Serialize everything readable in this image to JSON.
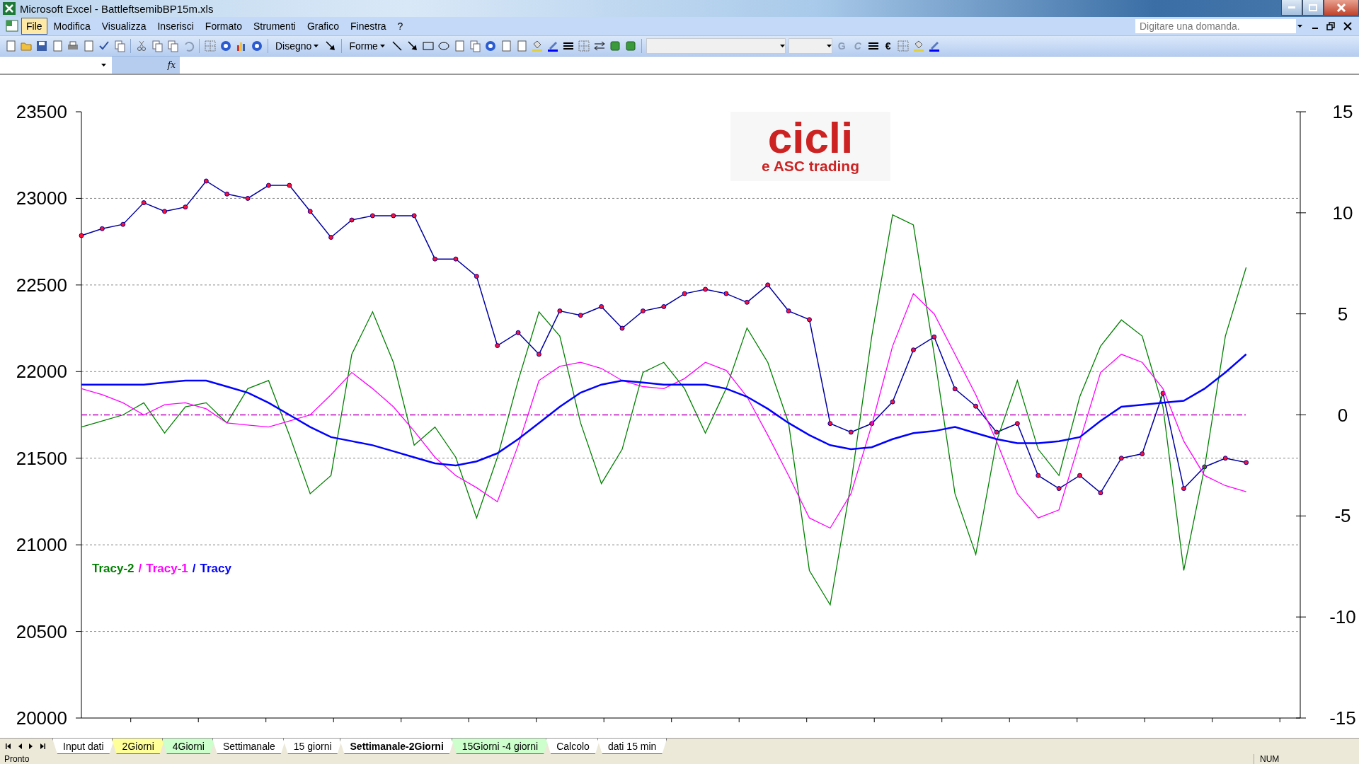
{
  "window": {
    "title": "Microsoft Excel - BattleftsemibBP15m.xls"
  },
  "menu": [
    {
      "label": "File",
      "selected": true
    },
    {
      "label": "Modifica",
      "selected": false
    },
    {
      "label": "Visualizza",
      "selected": false
    },
    {
      "label": "Inserisci",
      "selected": false
    },
    {
      "label": "Formato",
      "selected": false
    },
    {
      "label": "Strumenti",
      "selected": false
    },
    {
      "label": "Grafico",
      "selected": false
    },
    {
      "label": "Finestra",
      "selected": false
    },
    {
      "label": "?",
      "selected": false
    }
  ],
  "help_search": {
    "placeholder": "Digitare una domanda."
  },
  "drawing_toolbar": {
    "draw_menu": "Disegno",
    "shapes_menu": "Forme"
  },
  "format_toolbar": {
    "bold": "G",
    "italic": "C",
    "euro": "€"
  },
  "formula_bar": {
    "fx": "fx"
  },
  "logo": {
    "title": "cicli",
    "subtitle": "e ASC trading"
  },
  "legend": {
    "separators": [
      "/",
      "/"
    ]
  },
  "chart_price": {
    "chart_data": {
      "type": "line",
      "grid": true,
      "categories": [
        null,
        null,
        null,
        null,
        null,
        null,
        null,
        null,
        null,
        null,
        null,
        null,
        null,
        null,
        null,
        null,
        null,
        null,
        null,
        null,
        null,
        null,
        null,
        null,
        null,
        null,
        null,
        null,
        null,
        null,
        null,
        null,
        null,
        null,
        null,
        null,
        null,
        null,
        null,
        null,
        null,
        null,
        null,
        null,
        null,
        null,
        null,
        null,
        null,
        null,
        null,
        null,
        null,
        null,
        null,
        null,
        null
      ],
      "ylim": [
        20000,
        23500
      ],
      "yticks": [
        {
          "value": 20000,
          "label": "20000"
        },
        {
          "value": 20500,
          "label": "20500"
        },
        {
          "value": 21000,
          "label": "21000"
        },
        {
          "value": 21500,
          "label": "21500"
        },
        {
          "value": 22000,
          "label": "22000"
        },
        {
          "value": 22500,
          "label": "22500"
        },
        {
          "value": 23000,
          "label": "23000"
        },
        {
          "value": 23500,
          "label": "23500"
        }
      ],
      "series": [
        {
          "color": "#0000a0",
          "marker": "circle",
          "values": [
            22785,
            22825,
            22850,
            22975,
            22925,
            22950,
            23100,
            23025,
            23000,
            23075,
            23075,
            22925,
            22775,
            22875,
            22900,
            22900,
            22900,
            22650,
            22650,
            22550,
            22150,
            22225,
            22100,
            22350,
            22325,
            22375,
            22250,
            22350,
            22375,
            22450,
            22475,
            22450,
            22400,
            22500,
            22350,
            22300,
            21700,
            21650,
            21700,
            21825,
            22125,
            22200,
            21900,
            21800,
            21650,
            21700,
            21400,
            21325,
            21400,
            21300,
            21500,
            21525,
            21875,
            21325,
            21450,
            21500,
            21475
          ]
        }
      ]
    }
  },
  "chart_oscillators": {
    "chart_data": {
      "type": "line",
      "categories": [
        null,
        null,
        null,
        null,
        null,
        null,
        null,
        null,
        null,
        null,
        null,
        null,
        null,
        null,
        null,
        null,
        null,
        null,
        null,
        null,
        null,
        null,
        null,
        null,
        null,
        null,
        null,
        null,
        null,
        null,
        null,
        null,
        null,
        null,
        null,
        null,
        null,
        null,
        null,
        null,
        null,
        null,
        null,
        null,
        null,
        null,
        null,
        null,
        null,
        null,
        null,
        null,
        null,
        null,
        null,
        null,
        null
      ],
      "ylim": [
        -15,
        15
      ],
      "yticks": [
        {
          "value": -15,
          "label": "-15"
        },
        {
          "value": -10,
          "label": "-10"
        },
        {
          "value": -5,
          "label": "-5"
        },
        {
          "value": 0,
          "label": "0"
        },
        {
          "value": 5,
          "label": "5"
        },
        {
          "value": 10,
          "label": "10"
        },
        {
          "value": 15,
          "label": "15"
        }
      ],
      "series": [
        {
          "color": "#c000c0",
          "line_style": "dashdot",
          "values": [
            0,
            0,
            0,
            0,
            0,
            0,
            0,
            0,
            0,
            0,
            0,
            0,
            0,
            0,
            0,
            0,
            0,
            0,
            0,
            0,
            0,
            0,
            0,
            0,
            0,
            0,
            0,
            0,
            0,
            0,
            0,
            0,
            0,
            0,
            0,
            0,
            0,
            0,
            0,
            0,
            0,
            0,
            0,
            0,
            0,
            0,
            0,
            0,
            0,
            0,
            0,
            0,
            0,
            0,
            0,
            0,
            0
          ]
        },
        {
          "name": "Tracy-2",
          "color": "#008000",
          "values": [
            -0.6,
            -0.3,
            0,
            0.6,
            -0.9,
            0.4,
            0.6,
            -0.4,
            1.3,
            1.7,
            -1.0,
            -3.9,
            -3.0,
            3.0,
            5.1,
            2.6,
            -1.5,
            -0.6,
            -2.1,
            -5.1,
            -2.1,
            1.7,
            5.1,
            3.9,
            -0.4,
            -3.4,
            -1.7,
            2.1,
            2.6,
            1.3,
            -0.9,
            1.3,
            4.3,
            2.6,
            -0.4,
            -7.7,
            -9.4,
            -3.4,
            3.9,
            9.9,
            9.4,
            3.0,
            -3.9,
            -6.9,
            -1.3,
            1.7,
            -1.7,
            -3.0,
            0.9,
            3.4,
            4.7,
            3.9,
            0.4,
            -7.7,
            -2.6,
            3.9,
            7.3
          ]
        },
        {
          "name": "Tracy-1",
          "color": "#ff00ff",
          "values": [
            1.3,
            1.0,
            0.6,
            0,
            0.5,
            0.6,
            0.3,
            -0.4,
            -0.5,
            -0.6,
            -0.3,
            0,
            1.0,
            2.1,
            1.3,
            0.4,
            -0.8,
            -2.1,
            -3.0,
            -3.6,
            -4.3,
            -1.5,
            1.7,
            2.4,
            2.6,
            2.3,
            1.7,
            1.4,
            1.3,
            1.8,
            2.6,
            2.2,
            0.9,
            -1.0,
            -3.0,
            -5.1,
            -5.6,
            -3.9,
            -0.5,
            3.4,
            6.0,
            5.0,
            3.0,
            1.0,
            -1.3,
            -3.9,
            -5.1,
            -4.7,
            -1.3,
            2.1,
            3.0,
            2.6,
            1.3,
            -1.3,
            -3.0,
            -3.5,
            -3.8
          ]
        },
        {
          "name": "Tracy",
          "color": "#0000ff",
          "values": [
            1.5,
            1.5,
            1.5,
            1.5,
            1.6,
            1.7,
            1.7,
            1.4,
            1.1,
            0.6,
            0,
            -0.6,
            -1.1,
            -1.3,
            -1.5,
            -1.8,
            -2.1,
            -2.4,
            -2.5,
            -2.3,
            -1.9,
            -1.2,
            -0.4,
            0.4,
            1.1,
            1.5,
            1.7,
            1.6,
            1.5,
            1.5,
            1.5,
            1.3,
            0.9,
            0.3,
            -0.4,
            -1.0,
            -1.5,
            -1.7,
            -1.6,
            -1.2,
            -0.9,
            -0.8,
            -0.6,
            -0.9,
            -1.2,
            -1.4,
            -1.4,
            -1.3,
            -1.1,
            -0.3,
            0.4,
            0.5,
            0.6,
            0.7,
            1.3,
            2.1,
            3.0
          ]
        }
      ]
    }
  },
  "sheet_tabs": [
    {
      "label": "Input dati",
      "selected": false,
      "color": "#ffffff"
    },
    {
      "label": "2Giorni",
      "selected": false,
      "color": "#ffff99"
    },
    {
      "label": "4Giorni",
      "selected": false,
      "color": "#ccffcc"
    },
    {
      "label": "Settimanale",
      "selected": false,
      "color": "#ffffff"
    },
    {
      "label": "15 giorni",
      "selected": false,
      "color": "#ffffff"
    },
    {
      "label": "Settimanale-2Giorni",
      "selected": true,
      "color": "#ffffff"
    },
    {
      "label": "15Giorni -4 giorni",
      "selected": false,
      "color": "#ccffcc"
    },
    {
      "label": "Calcolo",
      "selected": false,
      "color": "#ffffff"
    },
    {
      "label": "dati 15 min",
      "selected": false,
      "color": "#ffffff"
    }
  ],
  "status_bar": {
    "status": "Pronto",
    "num_lock": "NUM"
  }
}
